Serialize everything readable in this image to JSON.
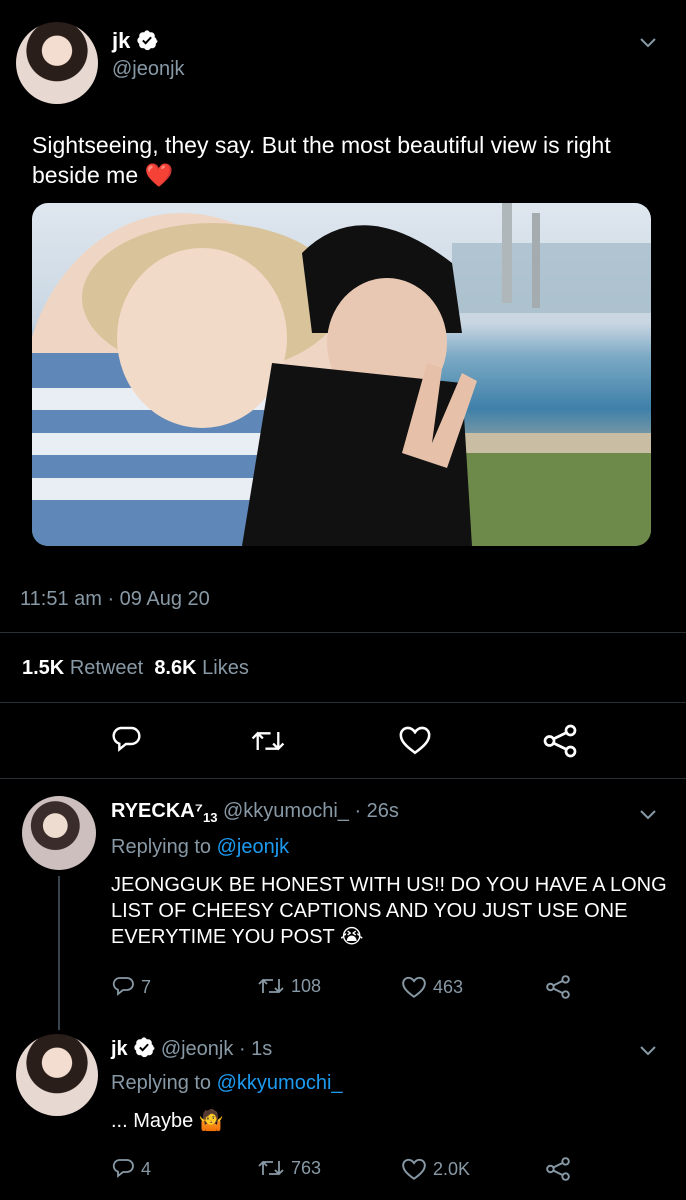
{
  "tweet": {
    "name": "jk",
    "handle": "@jeonjk",
    "text": "Sightseeing, they say. But the most beautiful view is right beside me",
    "emoji": "❤️",
    "timestamp": "11:51 am · 09 Aug 20",
    "retweets_count": "1.5K",
    "retweets_label": "Retweet",
    "likes_count": "8.6K",
    "likes_label": "Likes"
  },
  "reply1": {
    "name": "RYECKA⁷",
    "sub": "13",
    "handle": "@kkyumochi_",
    "time": "· 26s",
    "replying_prefix": "Replying to",
    "replying_to": "@jeonjk",
    "text": "JEONGGUK BE HONEST WITH US!! DO YOU HAVE A LONG LIST OF CHEESY CAPTIONS AND YOU JUST USE ONE EVERYTIME YOU POST",
    "emoji": "😭",
    "replies": "7",
    "retweets": "108",
    "likes": "463"
  },
  "reply2": {
    "name": "jk",
    "handle": "@jeonjk",
    "time": "· 1s",
    "replying_prefix": "Replying to",
    "replying_to": "@kkyumochi_",
    "text": "... Maybe",
    "emoji": "🤷",
    "replies": "4",
    "retweets": "763",
    "likes": "2.0K"
  },
  "colors": {
    "background": "#000000",
    "muted": "#8899a6",
    "link": "#1d9bf0",
    "verified": "#ffffff"
  }
}
